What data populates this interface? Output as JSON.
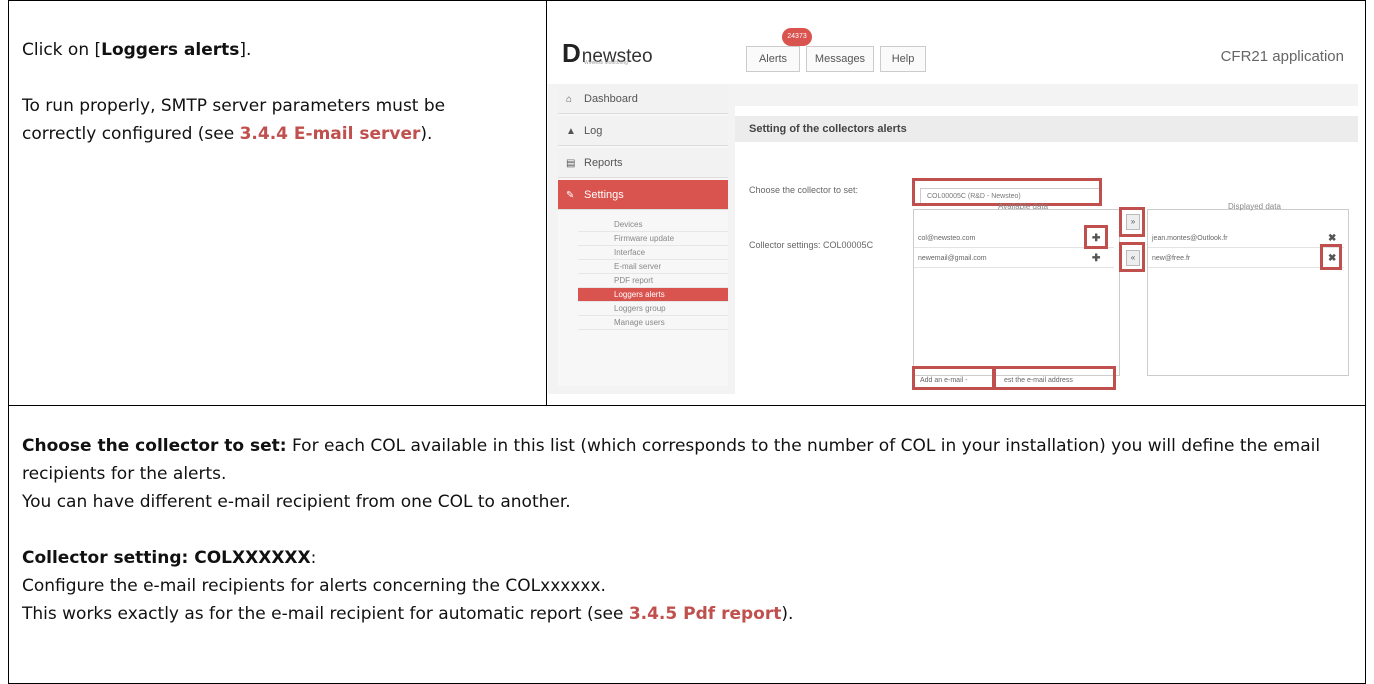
{
  "left_panel": {
    "instruction_prefix": "Click on [",
    "instruction_bold": "Loggers alerts",
    "instruction_suffix": "].",
    "note_text": "To run properly, SMTP server parameters must be correctly configured (see ",
    "note_ref": "3.4.4 E-mail server",
    "note_end": ")."
  },
  "screenshot": {
    "logo_text": "newsteo",
    "logo_tagline": "Wireless Monitoring",
    "tabs": [
      "Alerts",
      "Messages",
      "Help"
    ],
    "alerts_badge": "24373",
    "app_title": "CFR21 application",
    "sidebar_items": [
      "Dashboard",
      "Log",
      "Reports",
      "Settings"
    ],
    "settings_subitems": [
      "Devices",
      "Firmware update",
      "Interface",
      "E-mail server",
      "PDF report",
      "Loggers alerts",
      "Loggers group",
      "Manage users"
    ],
    "panel_title": "Setting of the collectors alerts",
    "choose_label": "Choose the collector to set:",
    "choose_value": "COL00005C (R&D - Newsteo)",
    "collector_settings_label": "Collector settings: COL00005C",
    "available_header": "Available data",
    "displayed_header": "Displayed data",
    "available_emails": [
      "col@newsteo.com",
      "newemail@gmail.com"
    ],
    "displayed_emails": [
      "jean.montes@Outlook.fr",
      "new@free.fr"
    ],
    "add_email_label": "Add an e-mail -",
    "email_placeholder": "est the e-mail address"
  },
  "bottom": {
    "choose_bold": "Choose the collector to set:",
    "choose_text": " For each COL available in this list (which corresponds to the number of COL in your installation) you will define the email recipients for the alerts.",
    "different_text": "You can have different e-mail recipient from one COL to another.",
    "collector_bold": "Collector setting: COLXXXXXX",
    "collector_colon": ":",
    "configure_text": "Configure the e-mail recipients for alerts concerning the COLxxxxxx.",
    "works_text": "This works exactly as for the e-mail recipient for automatic report (see ",
    "works_ref": "3.4.5 Pdf report",
    "works_end": ")."
  },
  "colors": {
    "accent_red": "#c0504d",
    "sidebar_active": "#d9534f"
  }
}
